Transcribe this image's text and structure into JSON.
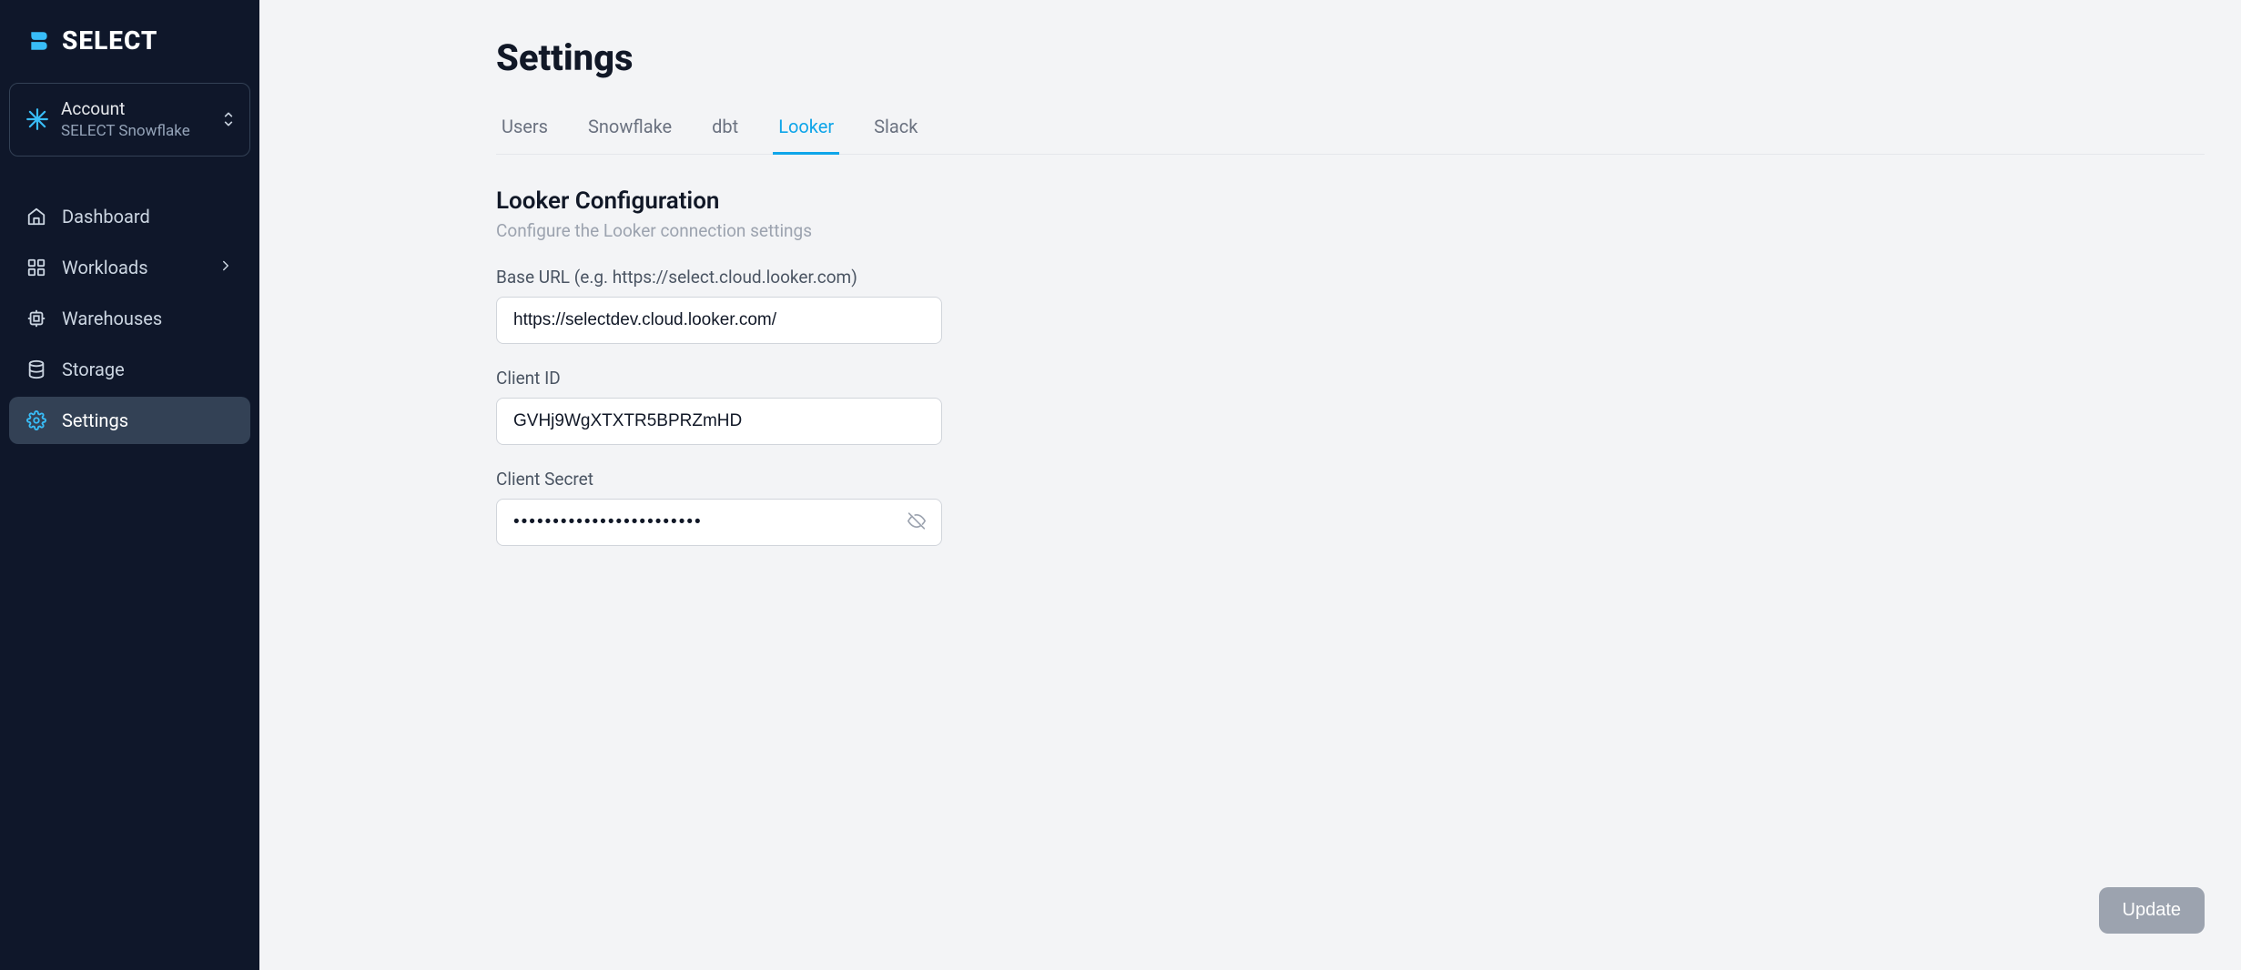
{
  "brand": {
    "name": "SELECT"
  },
  "account": {
    "label": "Account",
    "value": "SELECT Snowflake"
  },
  "sidebar": {
    "items": [
      {
        "label": "Dashboard"
      },
      {
        "label": "Workloads"
      },
      {
        "label": "Warehouses"
      },
      {
        "label": "Storage"
      },
      {
        "label": "Settings"
      }
    ]
  },
  "page": {
    "title": "Settings"
  },
  "tabs": [
    {
      "label": "Users"
    },
    {
      "label": "Snowflake"
    },
    {
      "label": "dbt"
    },
    {
      "label": "Looker"
    },
    {
      "label": "Slack"
    }
  ],
  "section": {
    "title": "Looker Configuration",
    "subtitle": "Configure the Looker connection settings"
  },
  "form": {
    "base_url": {
      "label": "Base URL (e.g. https://select.cloud.looker.com)",
      "value": "https://selectdev.cloud.looker.com/"
    },
    "client_id": {
      "label": "Client ID",
      "value": "GVHj9WgXTXTR5BPRZmHD"
    },
    "client_secret": {
      "label": "Client Secret",
      "value": "••••••••••••••••••••••••"
    }
  },
  "buttons": {
    "update": "Update"
  }
}
